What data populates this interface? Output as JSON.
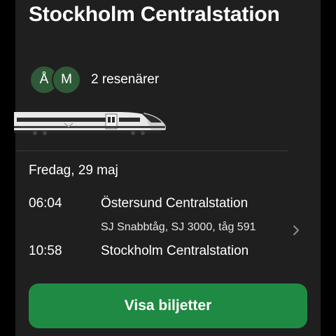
{
  "trip": {
    "title": "Stockholm Centralstation",
    "travelers": {
      "avatars": [
        "Å",
        "M"
      ],
      "label": "2 resenärer"
    },
    "date": "Fredag, 29 maj",
    "departure": {
      "time": "06:04",
      "station": "Östersund Centralstation"
    },
    "service": "SJ Snabbtåg, SJ 3000, tåg 591",
    "arrival": {
      "time": "10:58",
      "station": "Stockholm Centralstation"
    }
  },
  "actions": {
    "show_tickets": "Visa biljetter"
  },
  "icons": {
    "train": "train-illustration",
    "chevron": "chevron-right-icon"
  },
  "colors": {
    "card_background": "#1f1f1f",
    "page_background": "#000000",
    "avatar_background": "#2f5a37",
    "primary_button": "#1f8a43"
  }
}
